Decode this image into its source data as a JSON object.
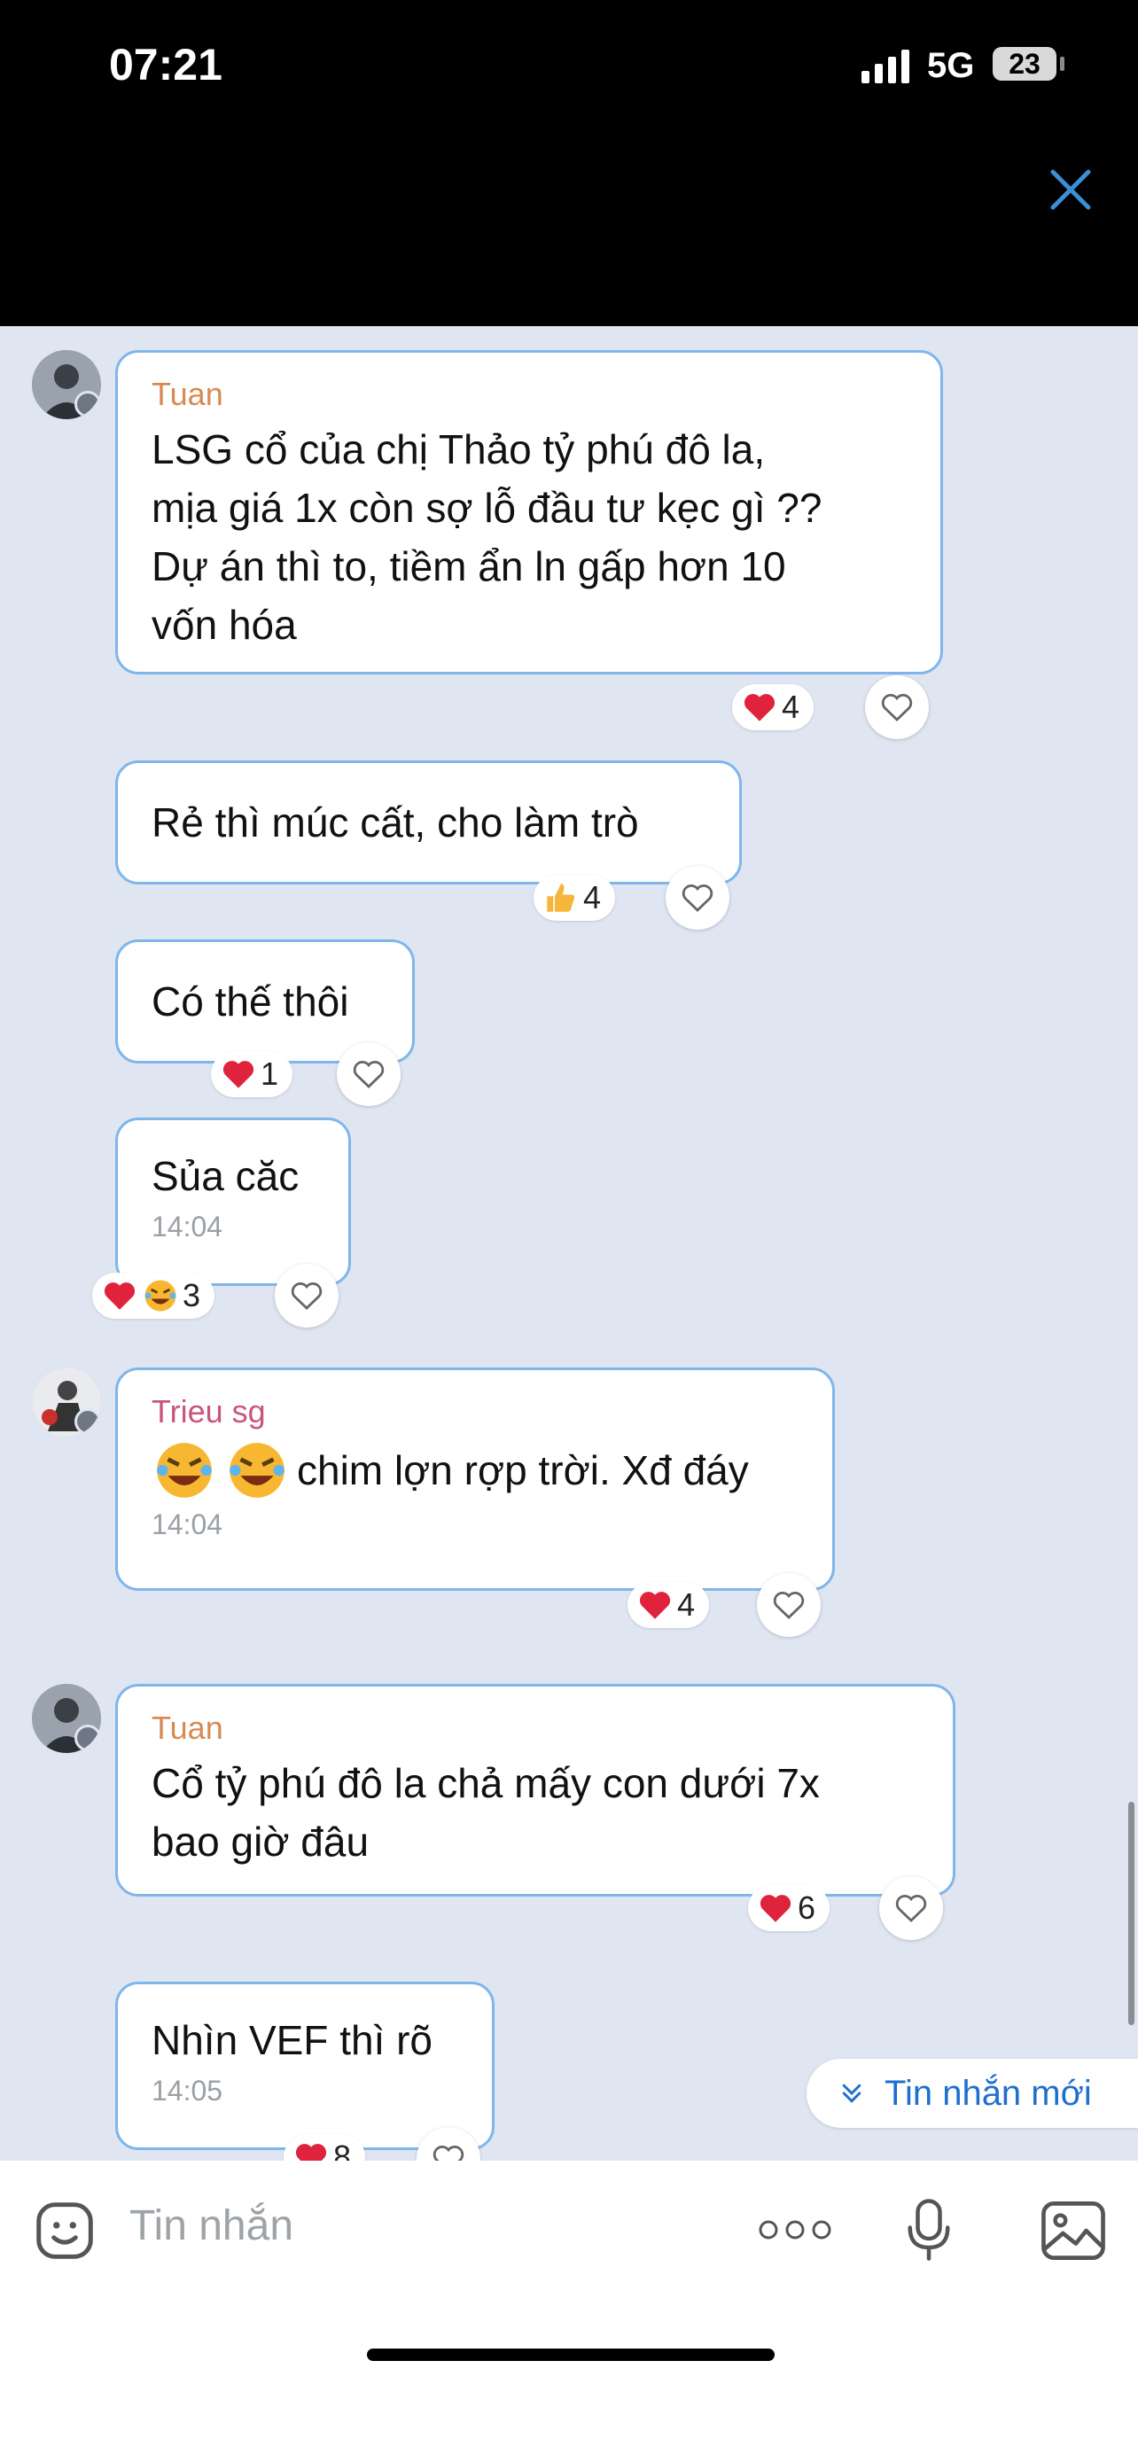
{
  "status_bar": {
    "time": "07:21",
    "network": "5G",
    "battery": "23"
  },
  "messages": [
    {
      "id": "m1",
      "sender": "Tuan",
      "sender_color": "#d88a52",
      "text": "LSG cổ của chị Thảo tỷ phú đô la,\nmịa giá 1x còn sợ lỗ đầu tư kẹc gì ??\nDự án thì to, tiềm ẩn ln gấp hơn 10\nvốn hóa",
      "time": "",
      "reactions": [
        "heart"
      ],
      "reaction_count": "4"
    },
    {
      "id": "m2",
      "sender": "",
      "text": "Rẻ thì múc cất, cho làm trò",
      "time": "",
      "reactions": [
        "thumbs-up"
      ],
      "reaction_count": "4"
    },
    {
      "id": "m3",
      "sender": "",
      "text": "Có thế thôi",
      "time": "",
      "reactions": [
        "heart"
      ],
      "reaction_count": "1"
    },
    {
      "id": "m4",
      "sender": "",
      "text": "Sủa căc",
      "time": "14:04",
      "reactions": [
        "heart",
        "laughing-crying"
      ],
      "reaction_count": "3"
    },
    {
      "id": "m5",
      "sender": "Trieu sg",
      "sender_color": "#c9557e",
      "text": "chim lợn rợp trời. Xđ đáy",
      "time": "14:04",
      "reactions": [
        "heart"
      ],
      "reaction_count": "4"
    },
    {
      "id": "m6",
      "sender": "Tuan",
      "sender_color": "#d88a52",
      "text": "Cổ tỷ phú đô la chả mấy con dưới 7x\nbao giờ đâu",
      "time": "",
      "reactions": [
        "heart"
      ],
      "reaction_count": "6"
    },
    {
      "id": "m7",
      "sender": "",
      "text": "Nhìn VEF thì rõ",
      "time": "14:05",
      "reactions": [
        "heart"
      ],
      "reaction_count": "8"
    }
  ],
  "new_messages_button": {
    "label": "Tin nhắn mới"
  },
  "composer": {
    "placeholder": "Tin nhắn"
  },
  "colors": {
    "bubble_border": "#7fb6ea",
    "chat_background": "#dfe5f1",
    "accent": "#1f6fcf",
    "heart": "#e0233c"
  }
}
